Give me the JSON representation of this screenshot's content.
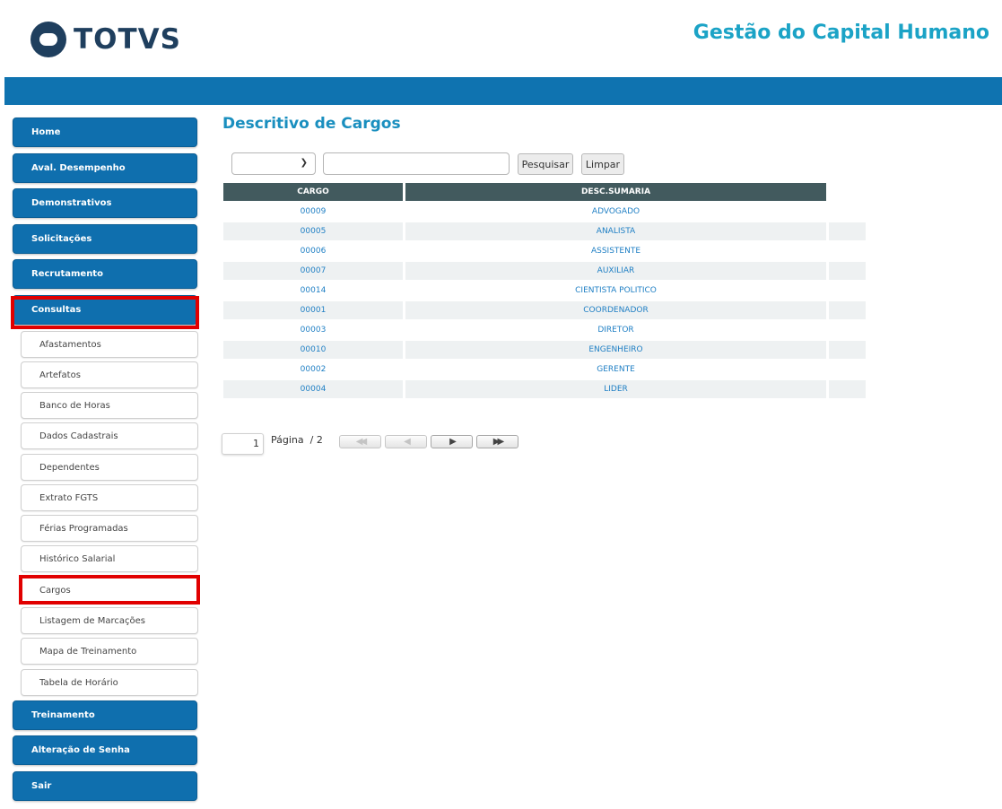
{
  "header": {
    "logo_text": "TOTVS",
    "app_title": "Gestão do Capital Humano"
  },
  "sidebar": {
    "main_items": [
      {
        "label": "Home"
      },
      {
        "label": "Aval. Desempenho"
      },
      {
        "label": "Demonstrativos"
      },
      {
        "label": "Solicitações"
      },
      {
        "label": "Recrutamento"
      },
      {
        "label": "Consultas",
        "selected": true
      }
    ],
    "sub_items": [
      {
        "label": "Afastamentos"
      },
      {
        "label": "Artefatos"
      },
      {
        "label": "Banco de Horas"
      },
      {
        "label": "Dados Cadastrais"
      },
      {
        "label": "Dependentes"
      },
      {
        "label": "Extrato FGTS"
      },
      {
        "label": "Férias Programadas"
      },
      {
        "label": "Histórico Salarial"
      },
      {
        "label": "Cargos",
        "selected": true
      },
      {
        "label": "Listagem de Marcações"
      },
      {
        "label": "Mapa de Treinamento"
      },
      {
        "label": "Tabela de Horário"
      }
    ],
    "bottom_items": [
      {
        "label": "Treinamento"
      },
      {
        "label": "Alteração de Senha"
      },
      {
        "label": "Sair"
      }
    ]
  },
  "main": {
    "title": "Descritivo de Cargos",
    "filter": {
      "select_value": "",
      "search_value": "",
      "search_button": "Pesquisar",
      "clear_button": "Limpar"
    },
    "table": {
      "columns": [
        "CARGO",
        "DESC.SUMARIA"
      ],
      "rows": [
        {
          "cargo": "00009",
          "desc": "ADVOGADO"
        },
        {
          "cargo": "00005",
          "desc": "ANALISTA"
        },
        {
          "cargo": "00006",
          "desc": "ASSISTENTE"
        },
        {
          "cargo": "00007",
          "desc": "AUXILIAR"
        },
        {
          "cargo": "00014",
          "desc": "CIENTISTA POLITICO"
        },
        {
          "cargo": "00001",
          "desc": "COORDENADOR"
        },
        {
          "cargo": "00003",
          "desc": "DIRETOR"
        },
        {
          "cargo": "00010",
          "desc": "ENGENHEIRO"
        },
        {
          "cargo": "00002",
          "desc": "GERENTE"
        },
        {
          "cargo": "00004",
          "desc": "LIDER"
        }
      ]
    },
    "pager": {
      "current_page": "1",
      "label": "Página",
      "total": "/ 2"
    }
  },
  "colors": {
    "brand_blue": "#0f73b0",
    "title_cyan": "#1ba3c6",
    "table_header": "#425a5e",
    "highlight_red": "#e10000"
  }
}
